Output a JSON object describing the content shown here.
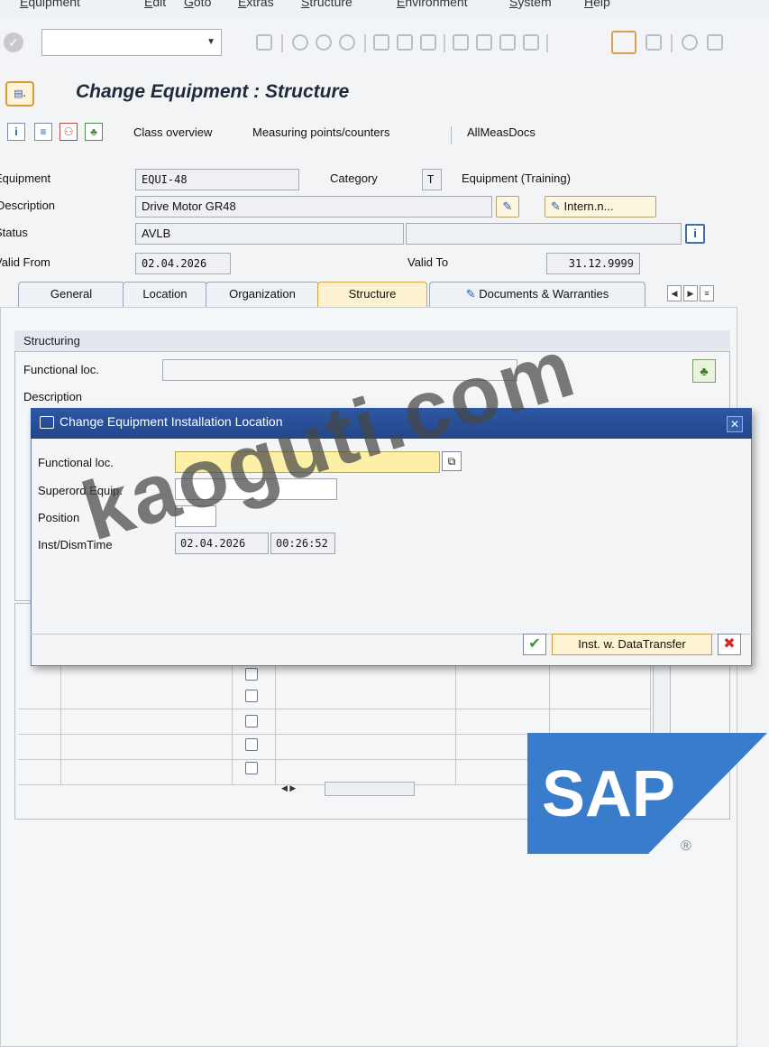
{
  "menu": [
    "Equipment",
    "Edit",
    "Goto",
    "Extras",
    "Structure",
    "Environment",
    "System",
    "Help"
  ],
  "window": {
    "title": "Change Equipment : Structure"
  },
  "app_toolbar": {
    "class_overview": "Class overview",
    "measuring_points": "Measuring points/counters",
    "all_meas_docs": "AllMeasDocs"
  },
  "header": {
    "equipment_label": "Equipment",
    "equipment_value": "EQUI-48",
    "category_label": "Category",
    "category_value": "T",
    "category_text": "Equipment (Training)",
    "description_label": "Description",
    "description_value": "Drive Motor GR48",
    "intern_button": "Intern.n...",
    "status_label": "Status",
    "status_value": "AVLB",
    "valid_from_label": "Valid From",
    "valid_from_value": "02.04.2026",
    "valid_to_label": "Valid To",
    "valid_to_value": "31.12.9999"
  },
  "tabs": [
    "General",
    "Location",
    "Organization",
    "Structure",
    "Documents & Warranties"
  ],
  "active_tab": "Structure",
  "structuring": {
    "group_title": "Structuring",
    "functional_loc_label": "Functional loc.",
    "description_label": "Description"
  },
  "dialog": {
    "title": "Change Equipment Installation Location",
    "functional_loc_label": "Functional loc.",
    "functional_loc_value": "",
    "superord_label": "Superord.Equip.",
    "superord_value": "",
    "position_label": "Position",
    "position_value": "",
    "inst_time_label": "Inst/DismTime",
    "inst_date_value": "02.04.2026",
    "inst_time_value": "00:26:52",
    "inst_button": "Inst. w. DataTransfer"
  },
  "watermark": "kaoguti.com",
  "logo": {
    "text": "SAP",
    "registered": "®"
  },
  "colors": {
    "sap_blue": "#2f6fc1",
    "dialog_title": "#2a509a",
    "required_field": "#fbf0a6",
    "active_tab": "#fdf2cf"
  }
}
